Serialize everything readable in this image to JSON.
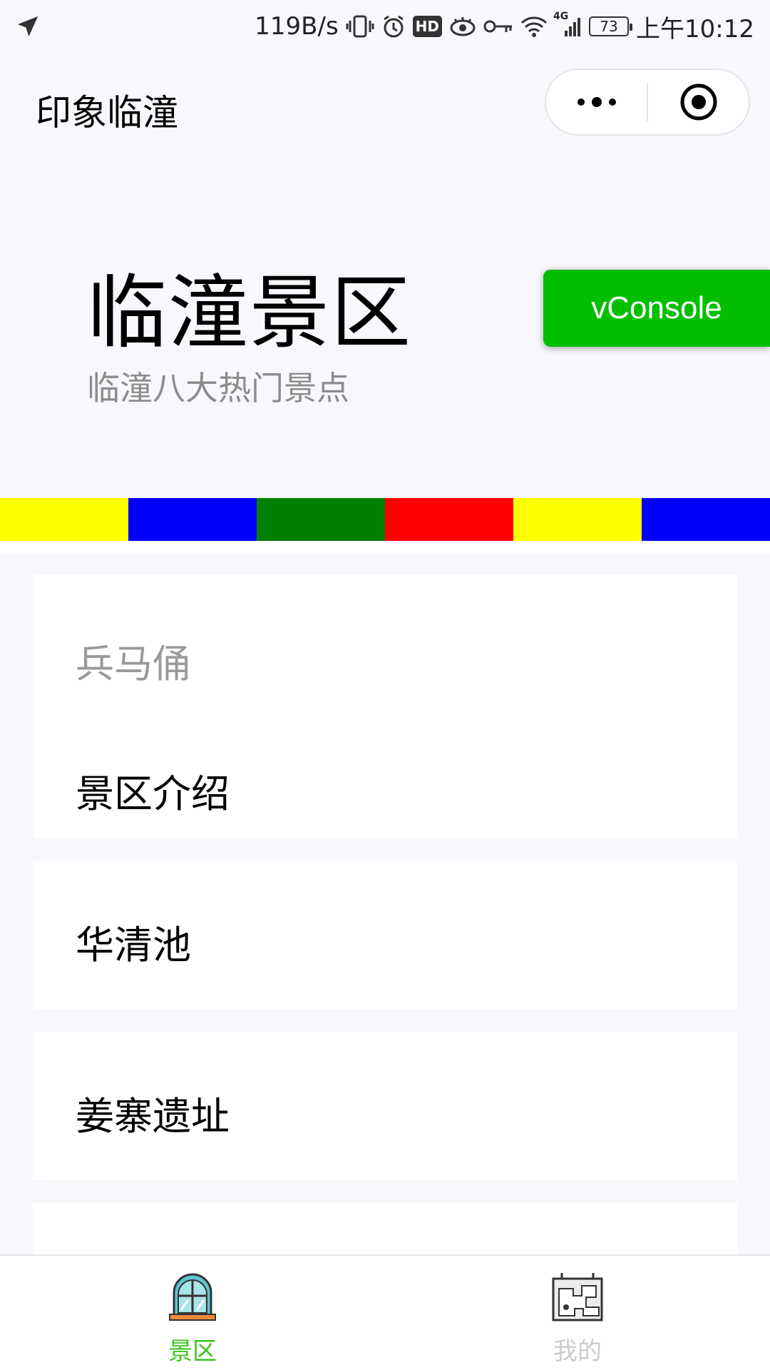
{
  "status_bar": {
    "net_speed": "119B/s",
    "hd_label": "HD",
    "network_type": "4G",
    "battery": "73",
    "time": "上午10:12"
  },
  "nav": {
    "title": "印象临潼"
  },
  "header": {
    "title": "临潼景区",
    "subtitle": "临潼八大热门景点"
  },
  "vconsole": {
    "label": "vConsole",
    "color": "#04be02"
  },
  "color_strip": [
    "#ffff00",
    "#0000ff",
    "#008000",
    "#ff0000",
    "#ffff00",
    "#0000ff"
  ],
  "cards": [
    {
      "title": "兵马俑",
      "link": "景区介绍"
    },
    {
      "link": "华清池"
    },
    {
      "link": "姜寨遗址"
    }
  ],
  "tabs": [
    {
      "label": "景区",
      "icon": "window-icon",
      "active": true,
      "color": "#3cc51f"
    },
    {
      "label": "我的",
      "icon": "map-board-icon",
      "active": false,
      "color": "#cccccc"
    }
  ]
}
